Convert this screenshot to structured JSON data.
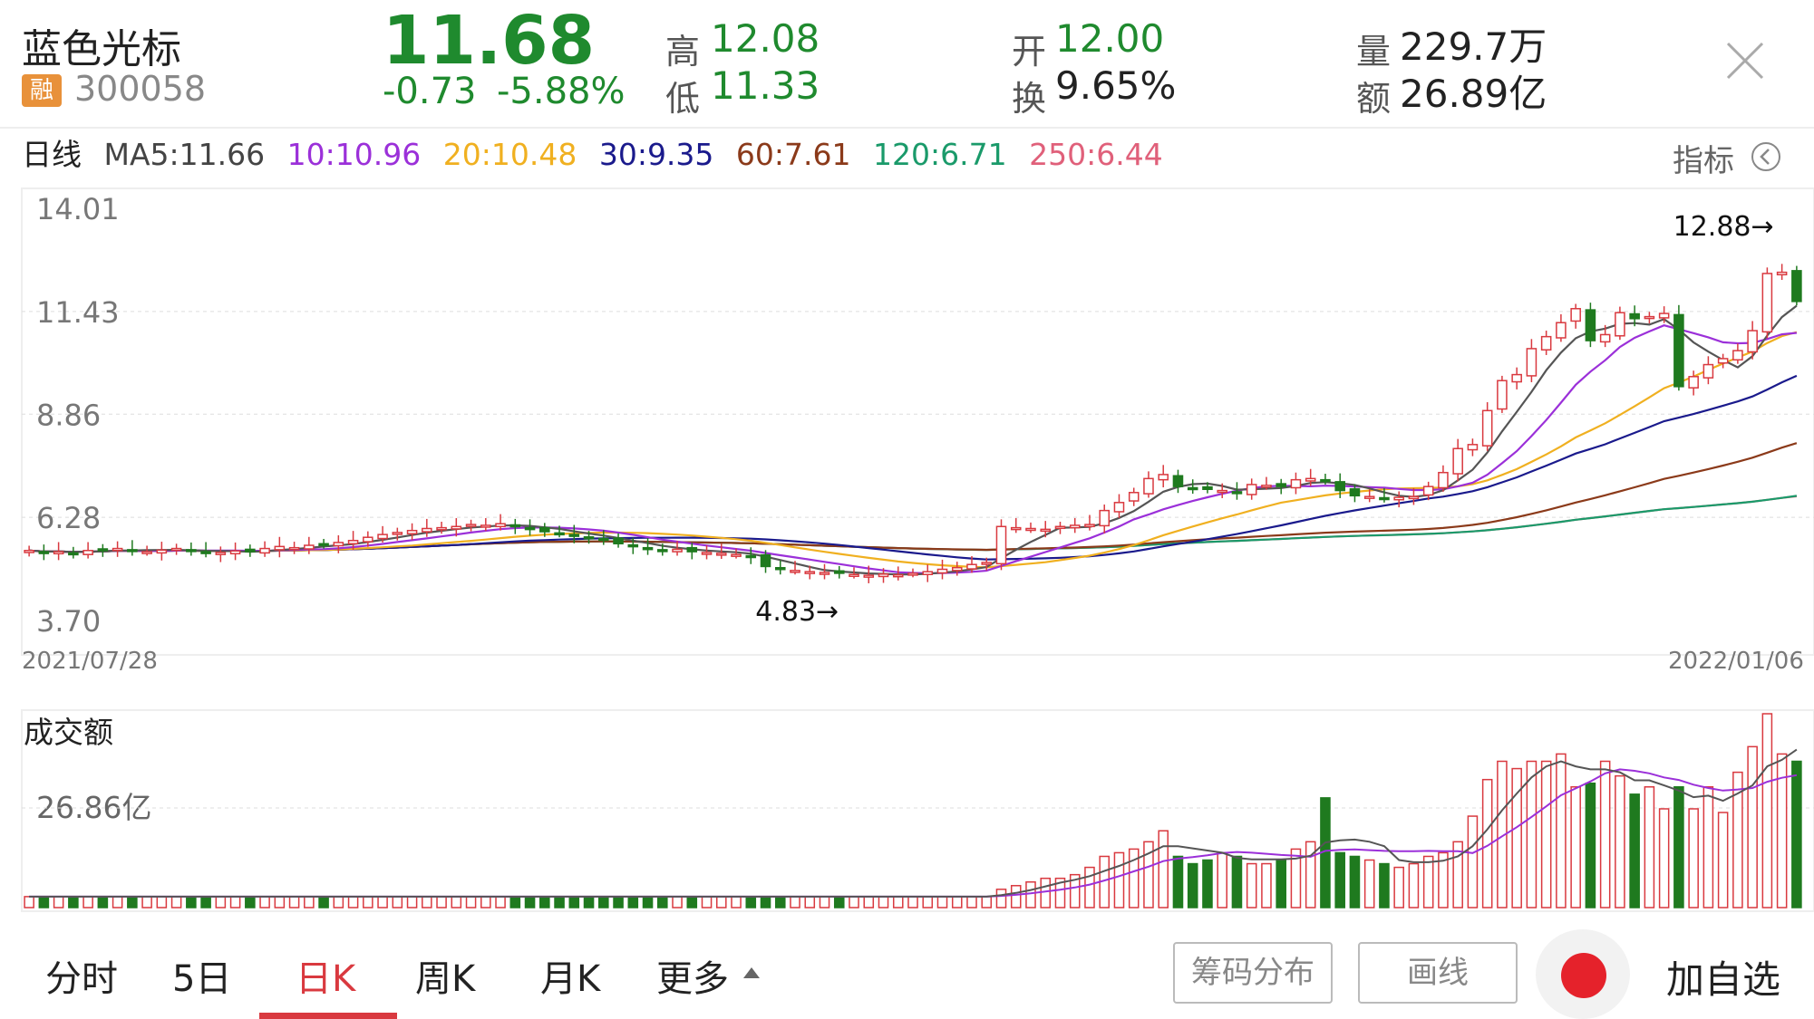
{
  "header": {
    "name": "蓝色光标",
    "badge": "融",
    "code": "300058",
    "price": "11.68",
    "change": "-0.73",
    "change_pct": "-5.88%",
    "high_label": "高",
    "high": "12.08",
    "low_label": "低",
    "low": "11.33",
    "open_label": "开",
    "open": "12.00",
    "turnover_label": "换",
    "turnover": "9.65%",
    "volume_label": "量",
    "volume": "229.7万",
    "amount_label": "额",
    "amount": "26.89亿"
  },
  "ma_bar": {
    "period": "日线",
    "ma5": "MA5:11.66",
    "ma10": "10:10.96",
    "ma20": "20:10.48",
    "ma30": "30:9.35",
    "ma60": "60:7.61",
    "ma120": "120:6.71",
    "ma250": "250:6.44",
    "indicator": "指标"
  },
  "chart_data": {
    "type": "candlestick",
    "y_ticks": [
      "14.01",
      "11.43",
      "8.86",
      "6.28",
      "3.70"
    ],
    "ylim": [
      3.7,
      14.01
    ],
    "start_date": "2021/07/28",
    "end_date": "2022/01/06",
    "max_label": "12.88→",
    "min_label": "4.83→",
    "max_value": 12.88,
    "min_value": 4.83,
    "colors": {
      "up": "#d9393f",
      "down": "#1f7a1f",
      "ma5": "#555555",
      "ma10": "#9b30d9",
      "ma20": "#f0b020",
      "ma30": "#1a1a8c",
      "ma60": "#8b3a1a",
      "ma120": "#1a9a6a",
      "ma250": "#e0607a"
    },
    "closes": [
      5.45,
      5.4,
      5.42,
      5.38,
      5.45,
      5.48,
      5.5,
      5.45,
      5.42,
      5.46,
      5.5,
      5.45,
      5.38,
      5.4,
      5.44,
      5.42,
      5.5,
      5.55,
      5.52,
      5.58,
      5.6,
      5.65,
      5.7,
      5.78,
      5.85,
      5.9,
      5.95,
      6.0,
      6.02,
      6.05,
      6.1,
      6.08,
      6.12,
      6.05,
      5.98,
      5.92,
      5.88,
      5.82,
      5.78,
      5.72,
      5.62,
      5.55,
      5.5,
      5.45,
      5.48,
      5.42,
      5.4,
      5.38,
      5.35,
      5.3,
      5.05,
      4.98,
      4.95,
      4.92,
      4.9,
      4.88,
      4.85,
      4.83,
      4.86,
      4.84,
      4.88,
      4.92,
      4.98,
      5.02,
      5.1,
      5.15,
      6.05,
      6.02,
      6.0,
      5.98,
      6.05,
      6.08,
      6.1,
      6.45,
      6.65,
      6.9,
      7.25,
      7.35,
      7.05,
      7.0,
      6.98,
      6.95,
      6.88,
      7.1,
      7.08,
      7.05,
      7.22,
      7.25,
      7.2,
      6.95,
      6.82,
      6.8,
      6.75,
      6.78,
      6.8,
      7.05,
      7.4,
      8.0,
      8.1,
      8.95,
      9.7,
      9.85,
      10.5,
      10.8,
      11.15,
      11.5,
      10.7,
      10.85,
      11.4,
      11.25,
      11.3,
      11.38,
      9.55,
      9.8,
      10.1,
      10.25,
      10.45,
      10.95,
      12.38,
      12.41,
      11.68
    ],
    "volume": {
      "label": "成交额",
      "tick": "26.86亿",
      "values": [
        3,
        3,
        3,
        3,
        3,
        3,
        3,
        3,
        3,
        3,
        3,
        3,
        3,
        3,
        3,
        3,
        3,
        3,
        3,
        3,
        3,
        3,
        3,
        3,
        3,
        3,
        3,
        3,
        3,
        3,
        3,
        3,
        3,
        3,
        3,
        3,
        3,
        3,
        3,
        3,
        3,
        3,
        3,
        3,
        3,
        3,
        3,
        3,
        3,
        3,
        3,
        3,
        3,
        3,
        3,
        3,
        3,
        3,
        3,
        3,
        3,
        3,
        3,
        3,
        3,
        3,
        5,
        6,
        7,
        8,
        8,
        9,
        11,
        14,
        15,
        16,
        18,
        21,
        14,
        12,
        13,
        15,
        14,
        12,
        12,
        13,
        16,
        18,
        30,
        15,
        14,
        13,
        12,
        11,
        12,
        14,
        15,
        18,
        25,
        35,
        40,
        38,
        40,
        40,
        42,
        33,
        34,
        40,
        36,
        31,
        33,
        27,
        33,
        27,
        33,
        26,
        37,
        44,
        53,
        42,
        40
      ]
    }
  },
  "tabs": {
    "fenshi": "分时",
    "five_day": "5日",
    "rk": "日K",
    "zk": "周K",
    "yk": "月K",
    "more": "更多"
  },
  "buttons": {
    "chip": "筹码分布",
    "draw": "画线",
    "add_watch": "加自选"
  }
}
